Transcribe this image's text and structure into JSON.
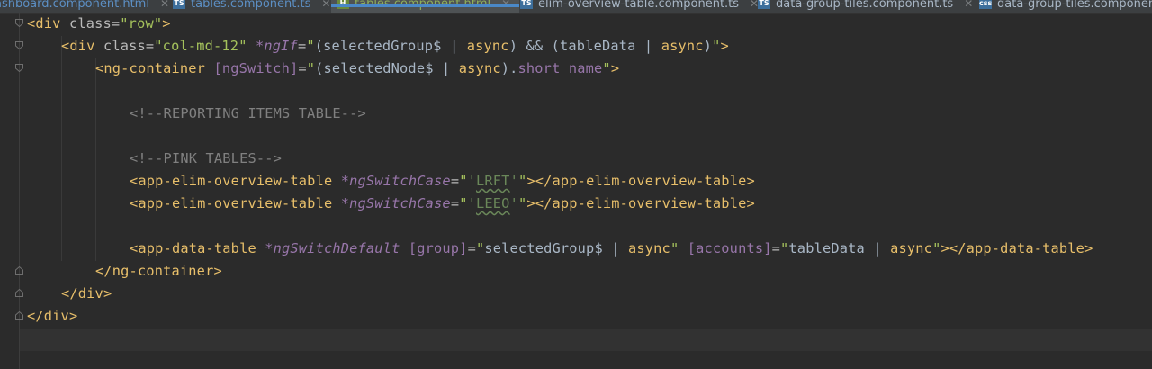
{
  "tabs": [
    {
      "label": "ashboard.component.html",
      "icon": "html-icon",
      "active": false
    },
    {
      "label": "tables.component.ts",
      "icon": "ts-icon",
      "active": false
    },
    {
      "label": "tables.component.html",
      "icon": "html-icon",
      "active": true
    },
    {
      "label": "elim-overview-table.component.ts",
      "icon": "ts-icon",
      "active": false
    },
    {
      "label": "data-group-tiles.component.ts",
      "icon": "ts-icon",
      "active": false
    },
    {
      "label": "data-group-tiles.componen",
      "icon": "css-icon",
      "active": false
    }
  ],
  "code": {
    "l1": {
      "t1": "<div ",
      "a1": "class=",
      "s1": "\"row\"",
      "t2": ">"
    },
    "l2": {
      "t1": "<div ",
      "a1": "class=",
      "s1": "\"col-md-12\"",
      "sp": " ",
      "d1": "*ngIf",
      "eq": "=",
      "q1": "\"",
      "p1": "(",
      "e1": "selectedGroup$",
      "pp1": " | ",
      "f1": "async",
      "p2": ")",
      "op": " && ",
      "p3": "(",
      "e2": "tableData",
      "pp2": " | ",
      "f2": "async",
      "p4": ")",
      "q2": "\"",
      "t2": ">"
    },
    "l3": {
      "t1": "<ng-container ",
      "b1": "[ngSwitch]",
      "eq": "=",
      "q1": "\"",
      "p1": "(",
      "e1": "selectedNode$",
      "pp1": " | ",
      "f1": "async",
      "p2": ")",
      "dot": ".",
      "pr": "short_name",
      "q2": "\"",
      "t2": ">"
    },
    "l5": {
      "c": "<!--REPORTING ITEMS TABLE-->"
    },
    "l7": {
      "c": "<!--PINK TABLES-->"
    },
    "l8": {
      "t1": "<app-elim-overview-table ",
      "d1": "*ngSwitchCase",
      "eq": "=",
      "q1": "\"",
      "lit1": "'",
      "lit2": "LRFT",
      "lit3": "'",
      "q2": "\"",
      "t2": "></app-elim-overview-table>"
    },
    "l9": {
      "t1": "<app-elim-overview-table ",
      "d1": "*ngSwitchCase",
      "eq": "=",
      "q1": "\"",
      "lit1": "'",
      "lit2": "LEEO",
      "lit3": "'",
      "q2": "\"",
      "t2": "></app-elim-overview-table>"
    },
    "l11": {
      "t1": "<app-data-table ",
      "d1": "*ngSwitchDefault",
      "sp1": " ",
      "b1": "[group]",
      "eq1": "=",
      "q1": "\"",
      "e1": "selectedGroup$",
      "pp1": " | ",
      "f1": "async",
      "q2": "\"",
      "sp2": " ",
      "b2": "[accounts]",
      "eq2": "=",
      "q3": "\"",
      "e2": "tableData",
      "pp2": " | ",
      "f2": "async",
      "q4": "\"",
      "t2": "></app-data-table>"
    },
    "l12": {
      "t": "</ng-container>"
    },
    "l13": {
      "t": "</div>"
    },
    "l14": {
      "t": "</div>"
    }
  }
}
